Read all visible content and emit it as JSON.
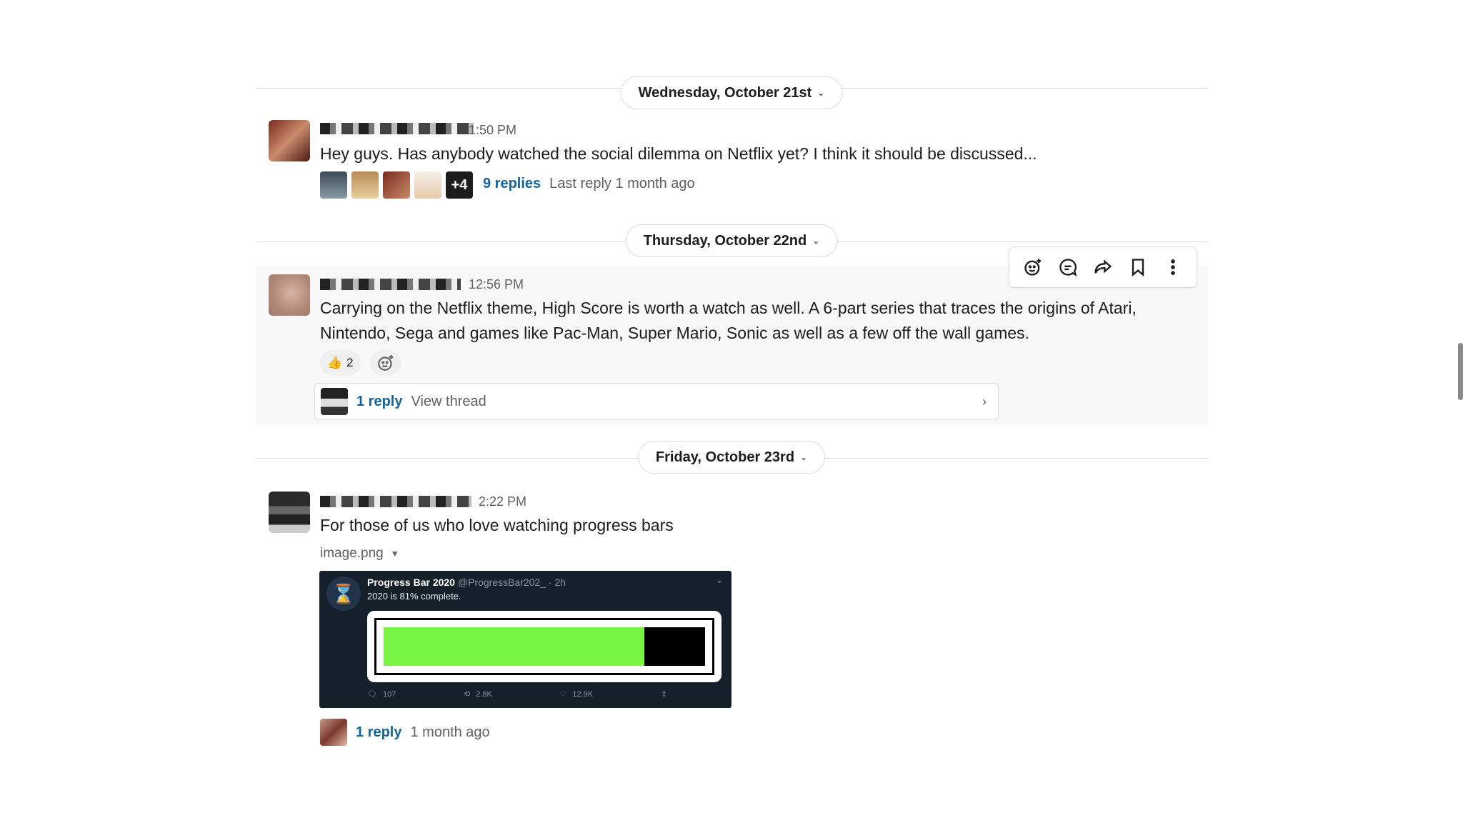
{
  "days": [
    {
      "label": "Wednesday, October 21st"
    },
    {
      "label": "Thursday, October 22nd"
    },
    {
      "label": "Friday, October 23rd"
    }
  ],
  "messages": [
    {
      "time": "1:50 PM",
      "text": "Hey guys. Has anybody watched the social dilemma on Netflix yet? I think it should be discussed...",
      "thread": {
        "extra_count": "+4",
        "replies": "9 replies",
        "last_reply": "Last reply 1 month ago"
      }
    },
    {
      "time": "12:56 PM",
      "text_line1": "Carrying on the Netflix theme, High Score is worth a watch as well. A 6-part series that traces the origins of Atari,",
      "text_line2": "Nintendo, Sega and games like Pac-Man, Super Mario, Sonic as well as a few off the wall games.",
      "reaction": {
        "emoji": "👍",
        "count": "2"
      },
      "thread": {
        "replies": "1 reply",
        "view": "View thread"
      }
    },
    {
      "time": "2:22 PM",
      "text": "For those of us who love watching progress bars",
      "file_name": "image.png",
      "thread": {
        "replies": "1 reply",
        "last_reply": "1 month ago"
      }
    }
  ],
  "tweet": {
    "name": "Progress Bar 2020",
    "handle": "@ProgressBar202_ · 2h",
    "text": "2020 is 81% complete.",
    "progress": 0.81,
    "fill_color": "#77f542",
    "replies": "107",
    "retweets": "2.8K",
    "likes": "12.9K"
  },
  "colors": {
    "link": "#1264a3",
    "hover_bg": "#f8f8f8"
  },
  "icons": [
    "add-reaction-icon",
    "reply-in-thread-icon",
    "share-icon",
    "bookmark-icon",
    "more-actions-icon"
  ]
}
